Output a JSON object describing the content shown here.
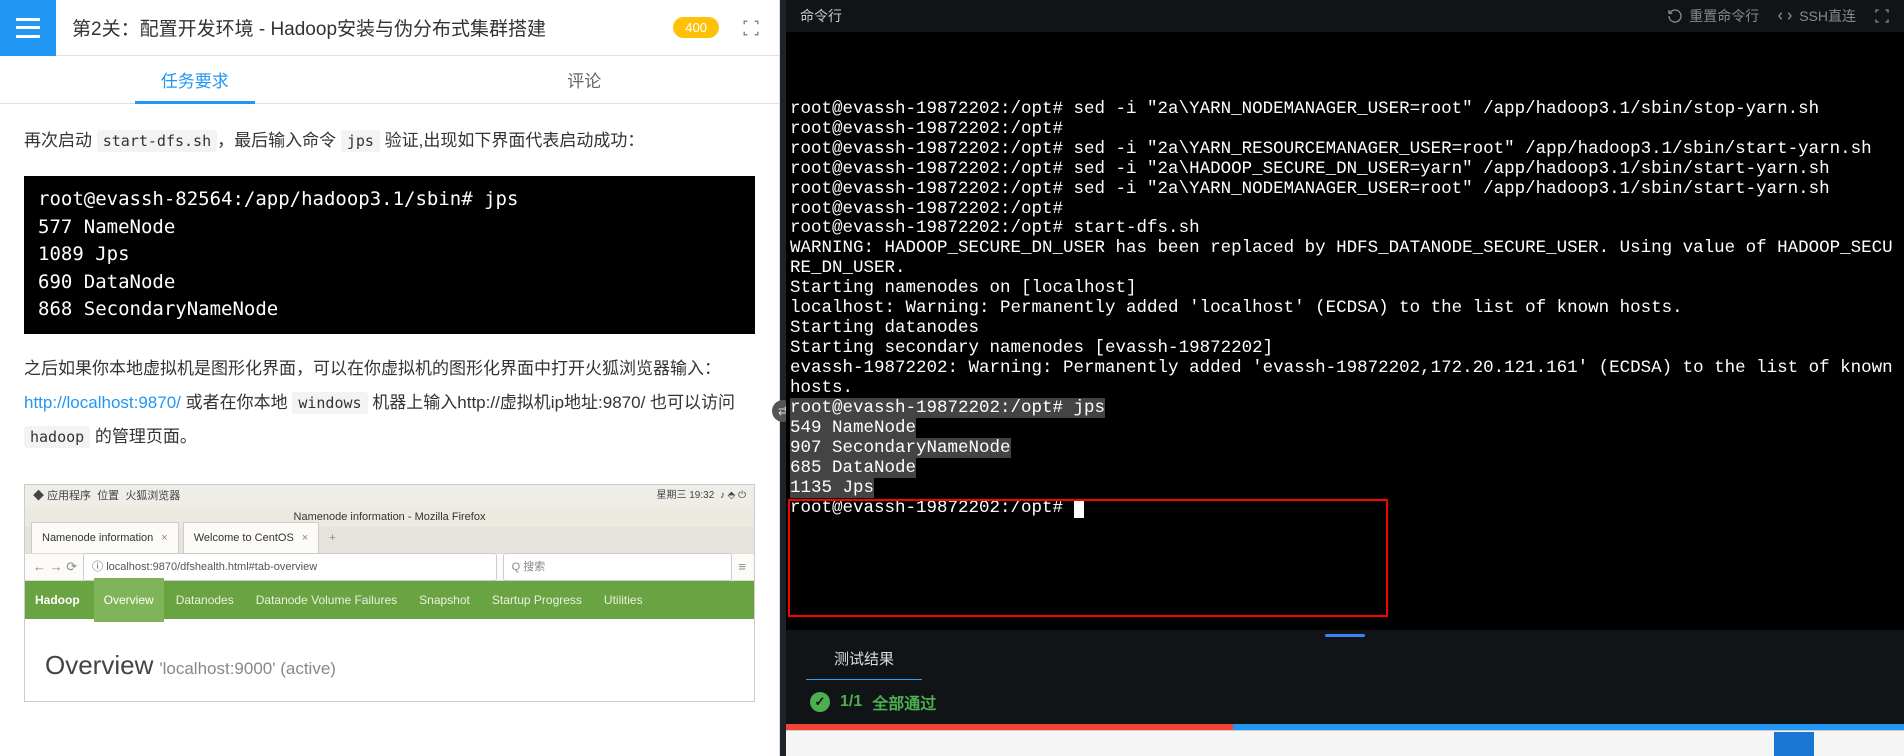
{
  "header": {
    "title": "第2关：配置开发环境 - Hadoop安装与伪分布式集群搭建",
    "score": "400"
  },
  "tabs": {
    "requirements": "任务要求",
    "comments": "评论"
  },
  "content": {
    "para1_a": "再次启动 ",
    "code1": "start-dfs.sh",
    "para1_b": "，最后输入命令 ",
    "code2": "jps",
    "para1_c": " 验证,出现如下界面代表启动成功：",
    "codeblock": "root@evassh-82564:/app/hadoop3.1/sbin# jps\n577 NameNode\n1089 Jps\n690 DataNode\n868 SecondaryNameNode",
    "para2_a": "之后如果你本地虚拟机是图形化界面，可以在你虚拟机的图形化界面中打开火狐浏览器输入：",
    "link": "http://localhost:9870/",
    "para2_b": "   或者在你本地 ",
    "code3": "windows",
    "para2_c": " 机器上输入http://虚拟机ip地址:9870/   也可以访问 ",
    "code4": "hadoop",
    "para2_d": " 的管理页面。"
  },
  "firefox": {
    "topbar_left1": "应用程序",
    "topbar_left2": "位置",
    "topbar_left3": "火狐浏览器",
    "topbar_right": "星期三 19:32",
    "window_title": "Namenode information - Mozilla Firefox",
    "tab1": "Namenode information",
    "tab2": "Welcome to CentOS",
    "url": "localhost:9870/dfshealth.html#tab-overview",
    "search_placeholder": "Q 搜索",
    "nav_brand": "Hadoop",
    "nav_items": [
      "Overview",
      "Datanodes",
      "Datanode Volume Failures",
      "Snapshot",
      "Startup Progress",
      "Utilities"
    ],
    "overview_title": "Overview",
    "overview_sub": "'localhost:9000' (active)"
  },
  "right": {
    "tab_label": "命令行",
    "reset": "重置命令行",
    "ssh": "SSH直连"
  },
  "terminal_lines": [
    "root@evassh-19872202:/opt# sed -i \"2a\\YARN_NODEMANAGER_USER=root\" /app/hadoop3.1/sbin/stop-yarn.sh",
    "root@evassh-19872202:/opt#",
    "root@evassh-19872202:/opt# sed -i \"2a\\YARN_RESOURCEMANAGER_USER=root\" /app/hadoop3.1/sbin/start-yarn.sh",
    "root@evassh-19872202:/opt# sed -i \"2a\\HADOOP_SECURE_DN_USER=yarn\" /app/hadoop3.1/sbin/start-yarn.sh",
    "root@evassh-19872202:/opt# sed -i \"2a\\YARN_NODEMANAGER_USER=root\" /app/hadoop3.1/sbin/start-yarn.sh",
    "root@evassh-19872202:/opt#",
    "root@evassh-19872202:/opt# start-dfs.sh",
    "WARNING: HADOOP_SECURE_DN_USER has been replaced by HDFS_DATANODE_SECURE_USER. Using value of HADOOP_SECURE_DN_USER.",
    "Starting namenodes on [localhost]",
    "localhost: Warning: Permanently added 'localhost' (ECDSA) to the list of known hosts.",
    "Starting datanodes",
    "Starting secondary namenodes [evassh-19872202]",
    "evassh-19872202: Warning: Permanently added 'evassh-19872202,172.20.121.161' (ECDSA) to the list of known hosts.",
    "root@evassh-19872202:/opt# jps",
    "549 NameNode",
    "907 SecondaryNameNode",
    "685 DataNode",
    "1135 Jps",
    "root@evassh-19872202:/opt# "
  ],
  "result": {
    "tab": "测试结果",
    "count": "1/1",
    "pass": "全部通过"
  }
}
